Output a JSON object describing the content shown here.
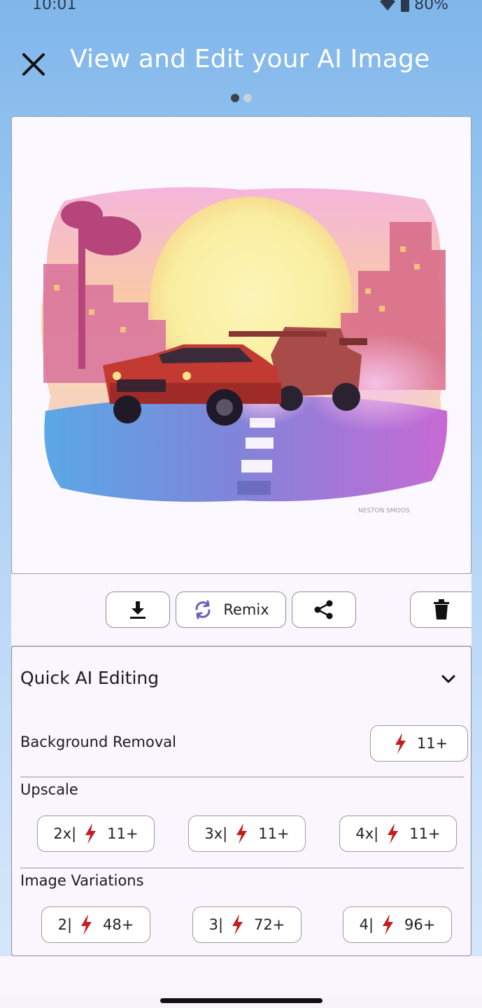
{
  "status_bar": {
    "time": "10:01",
    "battery": "80%",
    "icons": [
      "wifi-icon",
      "battery-icon"
    ]
  },
  "header": {
    "title": "View and Edit your AI Image",
    "close_icon": "close-icon"
  },
  "pager": {
    "count": 2,
    "active_index": 0
  },
  "image": {
    "watermark": "NESTON SMOOS"
  },
  "actions": {
    "download_icon": "download-icon",
    "remix_label": "Remix",
    "remix_icon": "remix-icon",
    "share_icon": "share-icon",
    "delete_icon": "trash-icon"
  },
  "quick_ai": {
    "title": "Quick AI Editing",
    "background_removal": {
      "label": "Background Removal",
      "cost": "11+"
    },
    "upscale": {
      "label": "Upscale",
      "options": [
        {
          "prefix": "2x|",
          "cost": "11+"
        },
        {
          "prefix": "3x|",
          "cost": "11+"
        },
        {
          "prefix": "4x|",
          "cost": "11+"
        }
      ]
    },
    "variations": {
      "label": "Image Variations",
      "options": [
        {
          "prefix": "2|",
          "cost": "48+"
        },
        {
          "prefix": "3|",
          "cost": "72+"
        },
        {
          "prefix": "4|",
          "cost": "96+"
        }
      ]
    }
  },
  "colors": {
    "bolt": "#c2201f",
    "remix_icon": "#6c5fb8",
    "title_text": "#ffffff"
  }
}
